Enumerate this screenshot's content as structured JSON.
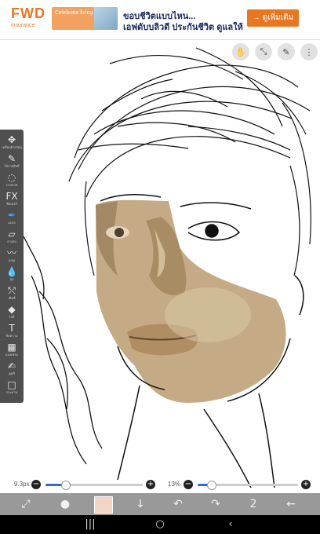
{
  "ad": {
    "logo": "FWD",
    "logo_sub": "insurance",
    "tile_text": "Celebrate living",
    "line1": "ขอบชีวิตแบบไหน...",
    "line2": "เอฟดับบลิวดี ประกันชีวิต ดูแลให้",
    "cta": "→ ดูเพิ่มเติม",
    "brand_color": "#e87722"
  },
  "top_buttons": [
    {
      "name": "hand-tool-icon",
      "label": "Hand"
    },
    {
      "name": "transform-icon",
      "label": "Transform"
    },
    {
      "name": "pen-icon",
      "label": "Pen"
    },
    {
      "name": "menu-icon",
      "label": "Menu"
    }
  ],
  "toolbar": {
    "tools": [
      {
        "name": "move-icon",
        "glyph": "✥",
        "label": "เคลื่อนย้ายวัตถุ"
      },
      {
        "name": "magic-wand-icon",
        "glyph": "✎",
        "label": "ไม้กายสิทธิ์"
      },
      {
        "name": "lasso-icon",
        "glyph": "◌",
        "label": "บ่วงบาศ"
      },
      {
        "name": "fx-icon",
        "glyph": "FX",
        "label": "ฟิลเตอร์"
      },
      {
        "name": "brush-icon",
        "glyph": "✒",
        "label": "แปรง",
        "active": true
      },
      {
        "name": "eraser-icon",
        "glyph": "▱",
        "label": "ยางลบ"
      },
      {
        "name": "smudge-icon",
        "glyph": "〰",
        "label": "เบลอ"
      },
      {
        "name": "blur-icon",
        "glyph": "💧",
        "label": "ลุ่ม"
      },
      {
        "name": "fill-icon",
        "glyph": "⤲",
        "label": "เติมสี"
      },
      {
        "name": "gradient-icon",
        "glyph": "◆",
        "label": "ไล่สี"
      },
      {
        "name": "text-icon",
        "glyph": "T",
        "label": "ข้อความ"
      },
      {
        "name": "frame-icon",
        "glyph": "▦",
        "label": "แบ่งเฟรม"
      },
      {
        "name": "eyedropper-icon",
        "glyph": "✍",
        "label": "ดูดสี"
      },
      {
        "name": "canvas-icon",
        "glyph": "□",
        "label": "กระดาษ"
      }
    ]
  },
  "sliders": {
    "brush_size": "9.3px",
    "brush_size_fraction": 0.2,
    "opacity": "13%",
    "opacity_fraction": 0.13
  },
  "bottom_bar": {
    "items": [
      {
        "name": "quick-tools-icon",
        "glyph": "⤢"
      },
      {
        "name": "brush-preview-icon",
        "glyph": "●"
      },
      {
        "name": "color-swatch",
        "color": "#f2d6c4"
      },
      {
        "name": "download-icon",
        "glyph": "↓"
      },
      {
        "name": "undo-icon",
        "glyph": "↶"
      },
      {
        "name": "redo-icon",
        "glyph": "↷"
      },
      {
        "name": "layers-icon",
        "glyph": "2"
      },
      {
        "name": "back-icon",
        "glyph": "←"
      }
    ]
  },
  "android_nav": {
    "recents": "|||",
    "home": "○",
    "back": "‹"
  },
  "colors": {
    "skin_base": "#bfa27a",
    "skin_shadow": "#8c7250",
    "skin_light": "#d9c7a4",
    "lip": "#b89268",
    "accent": "#2d6bd6"
  }
}
